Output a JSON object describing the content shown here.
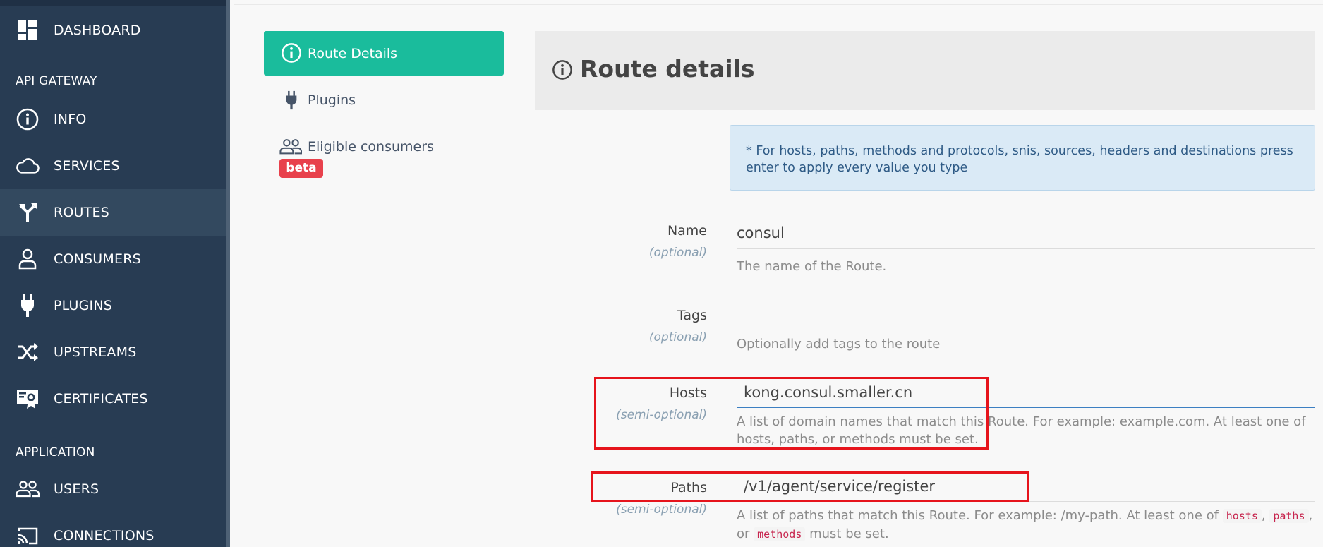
{
  "sidebar": {
    "dashboard": "DASHBOARD",
    "api_gateway_title": "API GATEWAY",
    "items": [
      {
        "label": "INFO",
        "icon": "info-icon"
      },
      {
        "label": "SERVICES",
        "icon": "cloud-icon"
      },
      {
        "label": "ROUTES",
        "icon": "routes-icon"
      },
      {
        "label": "CONSUMERS",
        "icon": "user-icon"
      },
      {
        "label": "PLUGINS",
        "icon": "plug-icon"
      },
      {
        "label": "UPSTREAMS",
        "icon": "shuffle-icon"
      },
      {
        "label": "CERTIFICATES",
        "icon": "certificate-icon"
      }
    ],
    "application_title": "APPLICATION",
    "app_items": [
      {
        "label": "USERS",
        "icon": "users-icon"
      },
      {
        "label": "CONNECTIONS",
        "icon": "cast-icon"
      }
    ],
    "active": "ROUTES"
  },
  "subnav": {
    "route_details": "Route Details",
    "plugins": "Plugins",
    "eligible_consumers": "Eligible consumers",
    "beta": "beta"
  },
  "header": {
    "title": "Route details"
  },
  "info_box": {
    "text": "* For hosts, paths, methods and protocols, snis, sources, headers and destinations press enter to apply every value you type"
  },
  "form": {
    "name": {
      "label": "Name",
      "sub": "(optional)",
      "value": "consul",
      "help": "The name of the Route."
    },
    "tags": {
      "label": "Tags",
      "sub": "(optional)",
      "value": "",
      "help": "Optionally add tags to the route"
    },
    "hosts": {
      "label": "Hosts",
      "sub": "(semi-optional)",
      "value": "kong.consul.smaller.cn",
      "help": "A list of domain names that match this Route. For example: example.com. At least one of hosts, paths, or methods must be set."
    },
    "paths": {
      "label": "Paths",
      "sub": "(semi-optional)",
      "value": "/v1/agent/service/register",
      "help_prefix": "A list of paths that match this Route. For example: /my-path. At least one of",
      "code1": "hosts",
      "sep1": ",",
      "code2": "paths",
      "sep2": ", or",
      "code3": "methods",
      "help_suffix": "must be set."
    }
  },
  "colors": {
    "sidebar_bg": "#283c53",
    "accent": "#1abc9c",
    "beta": "#e8414c",
    "highlight": "#e6141c"
  }
}
